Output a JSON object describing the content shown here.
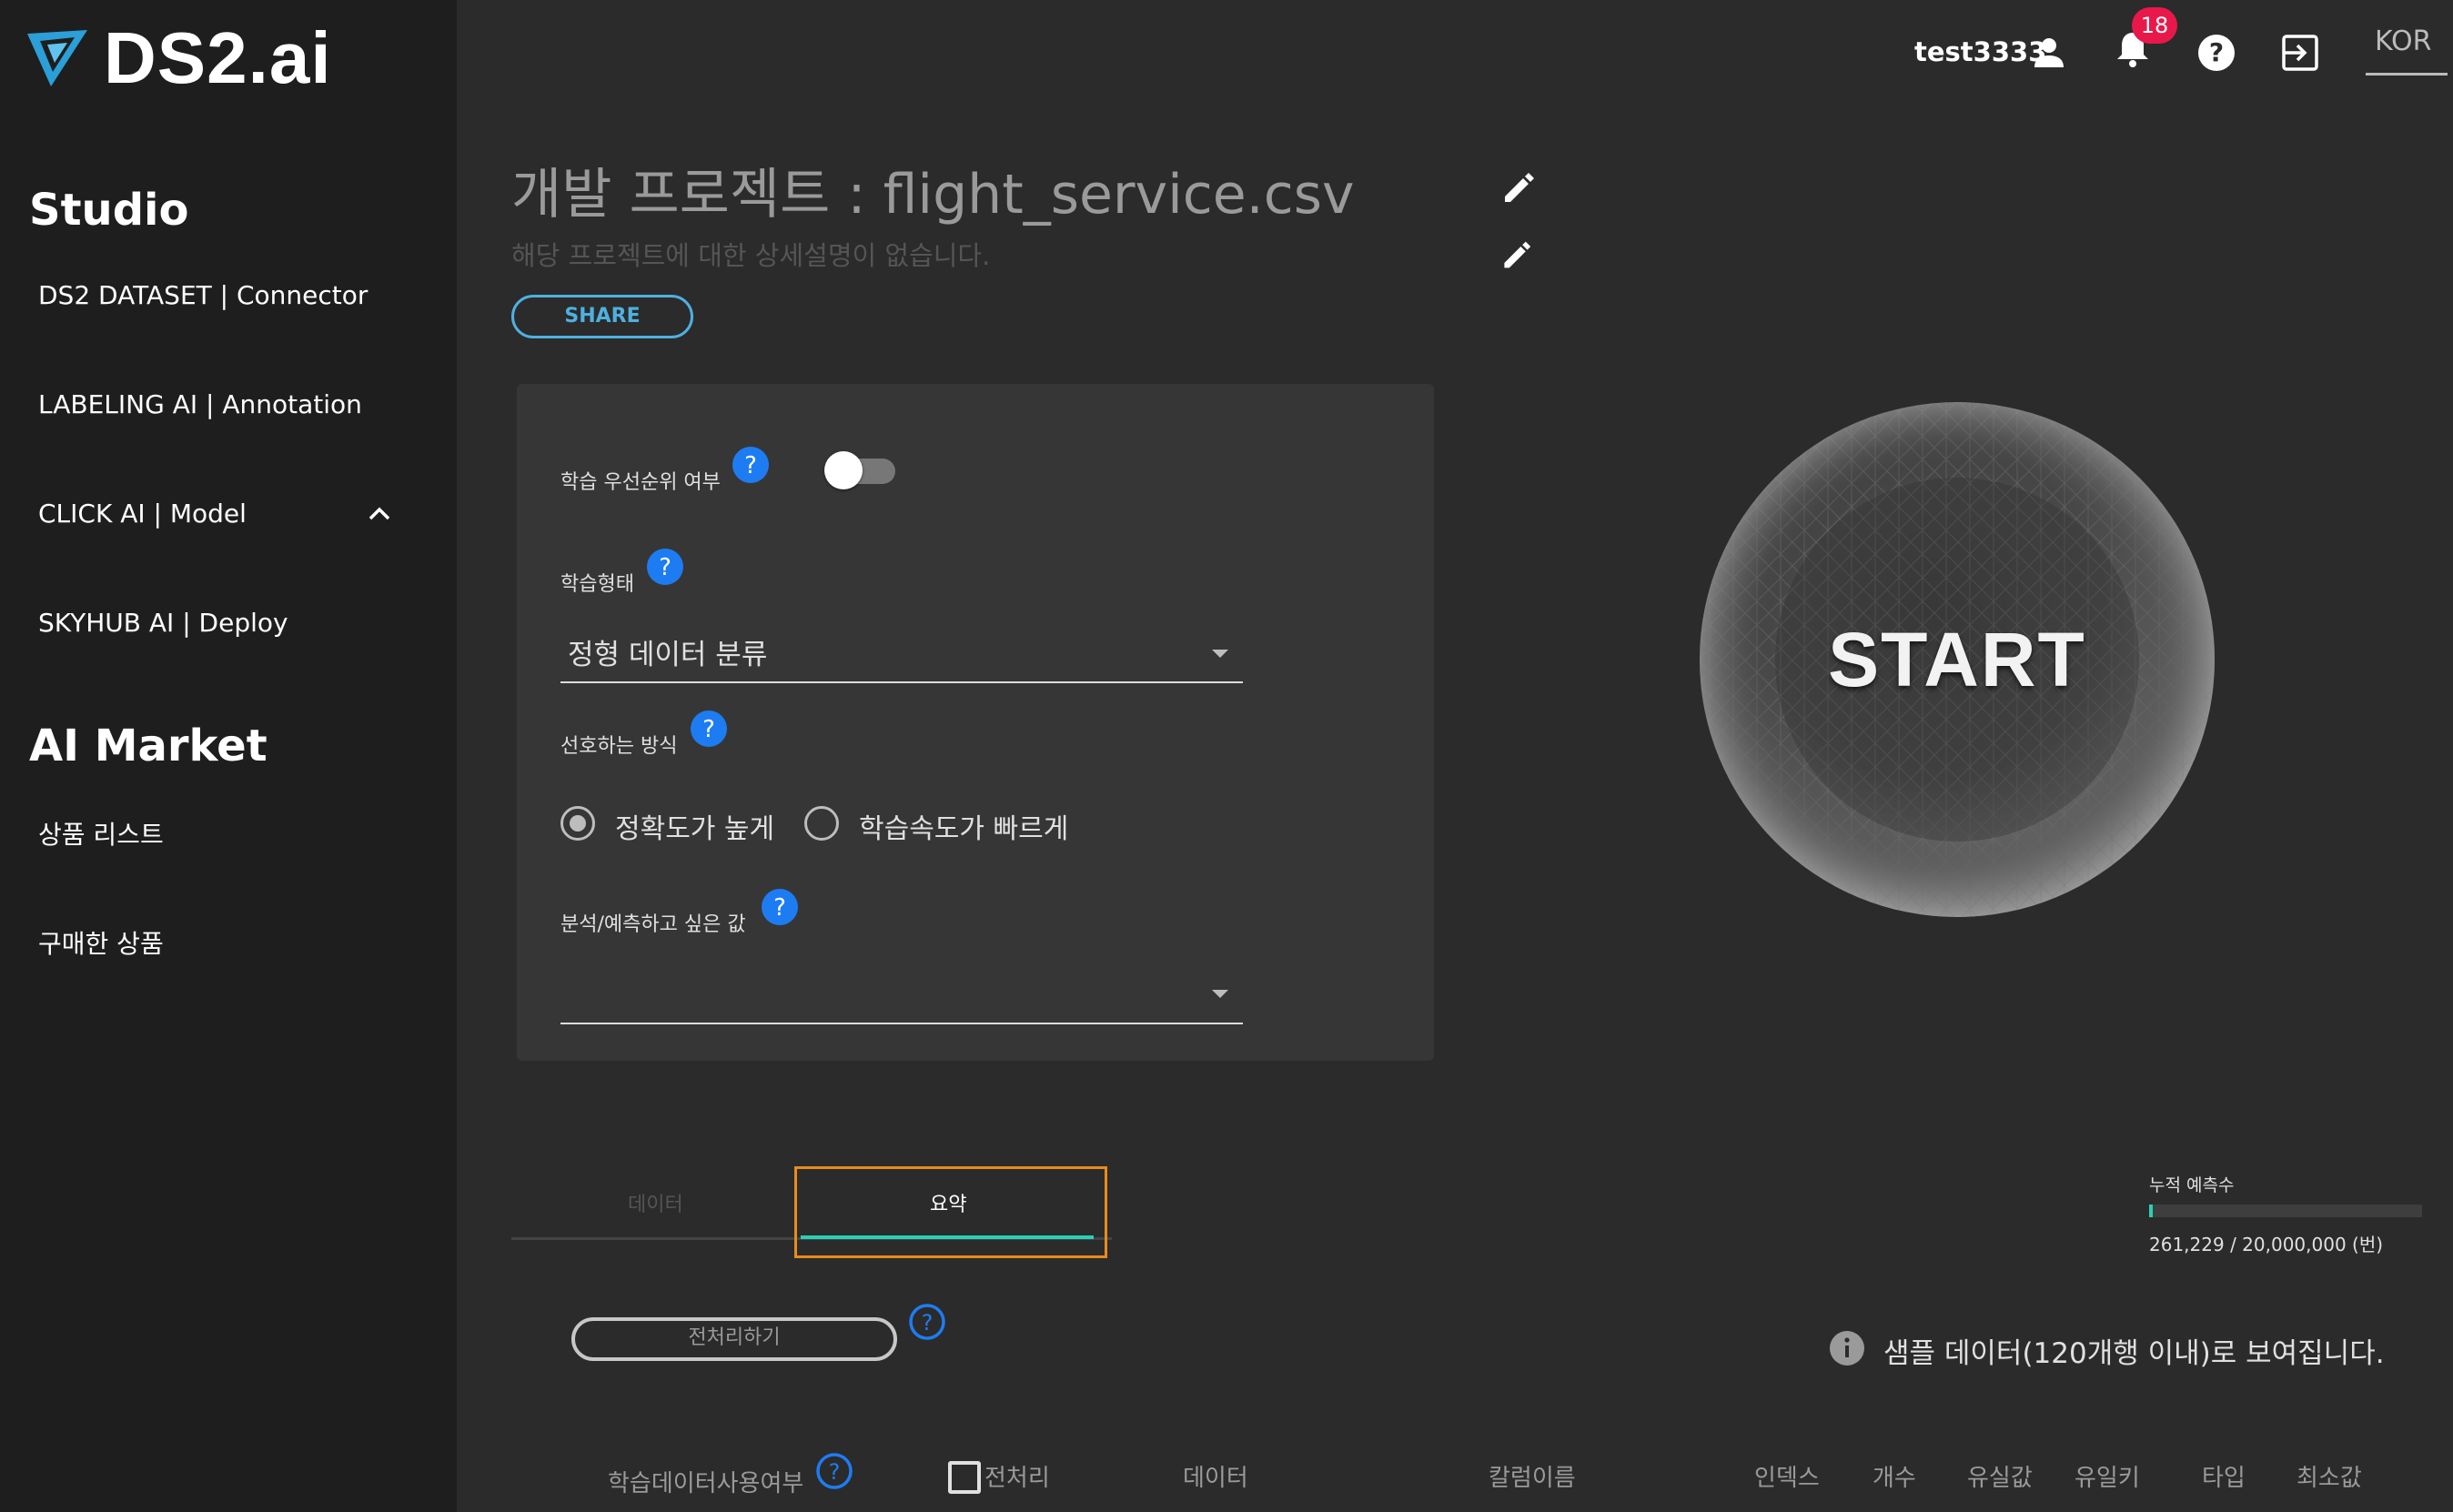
{
  "app": {
    "logo_text": "DS2.ai"
  },
  "sidebar": {
    "sections": [
      {
        "heading": "Studio"
      },
      {
        "heading": "AI Market"
      }
    ],
    "items": [
      {
        "label": "DS2 DATASET | Connector"
      },
      {
        "label": "LABELING AI | Annotation"
      },
      {
        "label": "CLICK AI | Model"
      },
      {
        "label": "SKYHUB AI | Deploy"
      },
      {
        "label": "상품 리스트"
      },
      {
        "label": "구매한 상품"
      }
    ]
  },
  "topbar": {
    "username": "test3333",
    "notification_count": "18",
    "language": "KOR",
    "icons": [
      "user-icon",
      "bell-icon",
      "help-icon",
      "logout-icon"
    ]
  },
  "project": {
    "title": "개발 프로젝트 : flight_service.csv",
    "description": "해당 프로젝트에 대한 상세설명이 없습니다.",
    "share_label": "SHARE"
  },
  "form": {
    "priority_label": "학습 우선순위 여부",
    "priority_enabled": false,
    "training_type_label": "학습형태",
    "training_type_value": "정형 데이터 분류",
    "preference_label": "선호하는 방식",
    "options": [
      {
        "label": "정확도가 높게",
        "selected": true
      },
      {
        "label": "학습속도가 빠르게",
        "selected": false
      }
    ],
    "target_label": "분석/예측하고 싶은 값",
    "target_value": ""
  },
  "start_button": {
    "label": "START"
  },
  "tabs": [
    {
      "label": "데이터",
      "active": false
    },
    {
      "label": "요약",
      "active": true
    }
  ],
  "stats": {
    "label": "누적 예측수",
    "value_text": "261,229 / 20,000,000 (번)",
    "used_fraction": 0.013
  },
  "preprocess": {
    "button_label": "전처리하기"
  },
  "info_note": "샘플 데이터(120개행 이내)로 보여집니다.",
  "table": {
    "columns": [
      "학습데이터사용여부",
      "전처리",
      "데이터",
      "칼럼이름",
      "인덱스",
      "개수",
      "유실값",
      "유일키",
      "타입",
      "최소값"
    ]
  },
  "colors": {
    "accent_blue": "#1e7cf2",
    "teal": "#2ad0b4",
    "orange_focus": "#e98b1d",
    "badge_red": "#e8194a",
    "share_blue": "#4fb0e0"
  }
}
